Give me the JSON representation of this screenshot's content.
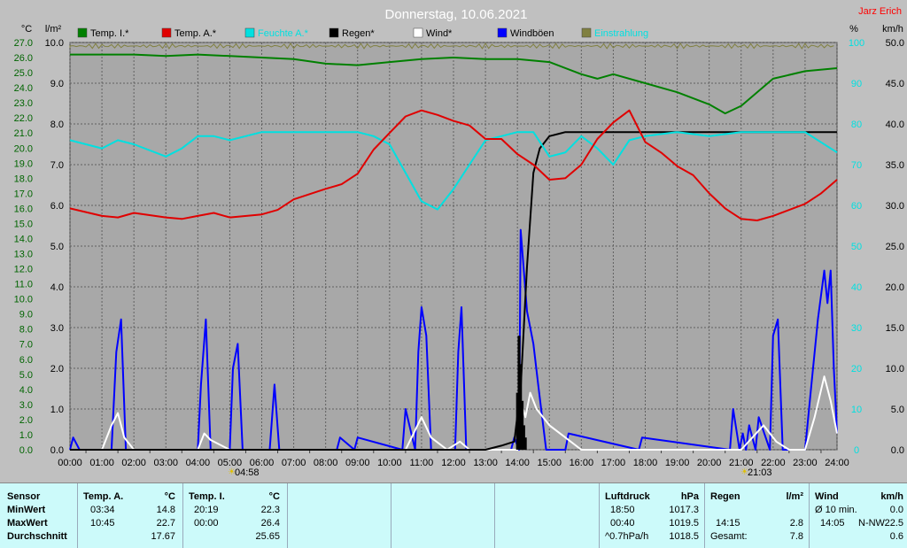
{
  "title": "Donnerstag, 10.06.2021",
  "author": "Jarz Erich",
  "colors": {
    "temp_i": "#008000",
    "temp_a": "#e00000",
    "feuchte": "#00e0e0",
    "regen": "#000000",
    "wind": "#ffffff",
    "windboeen": "#0000ff",
    "einstrahlung": "#808040",
    "plot_bg": "#a8a8a8",
    "grid": "#606060",
    "left_axis": "#006400",
    "panel_bg": "#ccfafa",
    "author": "#ff0000"
  },
  "chart_data": {
    "type": "line",
    "title": "Donnerstag, 10.06.2021",
    "x_unit": "hour",
    "xlim": [
      0,
      24
    ],
    "x_ticks": [
      "00:00",
      "01:00",
      "02:00",
      "03:00",
      "04:00",
      "05:00",
      "06:00",
      "07:00",
      "08:00",
      "09:00",
      "10:00",
      "11:00",
      "12:00",
      "13:00",
      "14:00",
      "15:00",
      "16:00",
      "17:00",
      "18:00",
      "19:00",
      "20:00",
      "21:00",
      "22:00",
      "23:00",
      "24:00"
    ],
    "axes": {
      "temp": {
        "label": "°C",
        "ylim": [
          0,
          27
        ],
        "ticks": [
          "0.0",
          "1.0",
          "2.0",
          "3.0",
          "4.0",
          "5.0",
          "6.0",
          "7.0",
          "8.0",
          "9.0",
          "10.0",
          "11.0",
          "12.0",
          "13.0",
          "14.0",
          "15.0",
          "16.0",
          "17.0",
          "18.0",
          "19.0",
          "20.0",
          "21.0",
          "22.0",
          "23.0",
          "24.0",
          "25.0",
          "26.0",
          "27.0"
        ]
      },
      "rain": {
        "label": "l/m²",
        "ylim": [
          0,
          10
        ],
        "ticks": [
          "0.0",
          "1.0",
          "2.0",
          "3.0",
          "4.0",
          "5.0",
          "6.0",
          "7.0",
          "8.0",
          "9.0",
          "10.0"
        ]
      },
      "humidity": {
        "label": "%",
        "ylim": [
          0,
          100
        ],
        "ticks": [
          "0",
          "10",
          "20",
          "30",
          "40",
          "50",
          "60",
          "70",
          "80",
          "90",
          "100"
        ]
      },
      "wind": {
        "label": "km/h",
        "ylim": [
          0,
          50
        ],
        "ticks": [
          "0.0",
          "5.0",
          "10.0",
          "15.0",
          "20.0",
          "25.0",
          "30.0",
          "35.0",
          "40.0",
          "45.0",
          "50.0"
        ]
      }
    },
    "legend": [
      "Temp. I.*",
      "Temp. A.*",
      "Feuchte A.*",
      "Regen*",
      "Wind*",
      "Windböen",
      "Einstrahlung"
    ],
    "sunrise": "04:58",
    "sunset": "21:03",
    "series": [
      {
        "name": "Temp. I.*",
        "axis": "temp",
        "color": "#008000",
        "x": [
          0,
          2,
          3,
          4,
          5,
          6,
          7,
          8,
          9,
          10,
          11,
          12,
          13,
          14,
          15,
          16,
          16.5,
          17,
          18,
          19,
          20,
          20.5,
          21,
          21.5,
          22,
          23,
          24
        ],
        "y": [
          26.2,
          26.2,
          26.1,
          26.2,
          26.1,
          26.0,
          25.9,
          25.6,
          25.5,
          25.7,
          25.9,
          26.0,
          25.9,
          25.9,
          25.7,
          24.9,
          24.6,
          24.9,
          24.3,
          23.7,
          22.9,
          22.3,
          22.8,
          23.7,
          24.6,
          25.1,
          25.3
        ]
      },
      {
        "name": "Temp. A.*",
        "axis": "temp",
        "color": "#e00000",
        "x": [
          0,
          1,
          1.5,
          2,
          3,
          3.5,
          4,
          4.5,
          5,
          6,
          6.5,
          7,
          8,
          8.5,
          9,
          9.5,
          10,
          10.5,
          11,
          11.5,
          12,
          12.5,
          13,
          13.5,
          14,
          14.5,
          15,
          15.5,
          16,
          16.5,
          17,
          17.5,
          18,
          18.5,
          19,
          19.5,
          20,
          20.5,
          21,
          21.5,
          22,
          23,
          23.5,
          24
        ],
        "y": [
          16.0,
          15.5,
          15.4,
          15.7,
          15.4,
          15.3,
          15.5,
          15.7,
          15.4,
          15.6,
          15.9,
          16.6,
          17.3,
          17.6,
          18.3,
          19.9,
          21.0,
          22.1,
          22.5,
          22.2,
          21.8,
          21.5,
          20.6,
          20.6,
          19.6,
          18.9,
          17.9,
          18.0,
          18.9,
          20.6,
          21.7,
          22.5,
          20.4,
          19.7,
          18.8,
          18.2,
          17.0,
          16.0,
          15.3,
          15.2,
          15.5,
          16.3,
          17.0,
          17.9
        ]
      },
      {
        "name": "Feuchte A.*",
        "axis": "humidity",
        "color": "#00e0e0",
        "x": [
          0,
          1,
          1.5,
          2,
          3,
          3.5,
          4,
          4.5,
          5,
          6,
          7,
          8,
          9,
          9.5,
          10,
          10.5,
          11,
          11.5,
          12,
          12.5,
          13,
          13.5,
          14,
          14.5,
          15,
          15.5,
          16,
          16.5,
          17,
          17.5,
          18,
          19,
          20,
          21,
          21.5,
          22,
          23,
          24
        ],
        "y": [
          76,
          74,
          76,
          75,
          72,
          74,
          77,
          77,
          76,
          78,
          78,
          78,
          78,
          77,
          75,
          68,
          61,
          59,
          64,
          70,
          76,
          77,
          78,
          78,
          72,
          73,
          77,
          74,
          70,
          76,
          77,
          78,
          77,
          78,
          78,
          78,
          78,
          73
        ]
      },
      {
        "name": "Regen*",
        "axis": "rain",
        "color": "#000000",
        "x": [
          0,
          13,
          13.5,
          13.9,
          14.1,
          14.3,
          14.5,
          14.7,
          15,
          15.5,
          16,
          24
        ],
        "y": [
          0,
          0,
          0.1,
          0.2,
          1.5,
          4.5,
          6.8,
          7.4,
          7.7,
          7.8,
          7.8,
          7.8
        ]
      },
      {
        "name": "Windböen",
        "axis": "wind",
        "color": "#0000ff",
        "x": [
          0,
          0.1,
          0.3,
          1.3,
          1.45,
          1.6,
          1.75,
          4,
          4.1,
          4.25,
          4.4,
          5,
          5.1,
          5.25,
          5.4,
          6.25,
          6.4,
          6.55,
          8.35,
          8.45,
          8.9,
          9,
          10.4,
          10.5,
          10.8,
          10.9,
          11,
          11.15,
          11.3,
          12.05,
          12.15,
          12.25,
          12.4,
          13.8,
          13.9,
          14.05,
          14.1,
          14.3,
          14.5,
          14.65,
          14.9,
          15.5,
          15.6,
          17.8,
          17.9,
          20.65,
          20.75,
          20.95,
          21.05,
          21.15,
          21.25,
          21.45,
          21.55,
          21.9,
          22,
          22.15,
          22.3,
          23,
          23.2,
          23.4,
          23.6,
          23.7,
          23.8,
          23.9,
          24
        ],
        "y": [
          0,
          1.5,
          0,
          0,
          12,
          16,
          0,
          0,
          8,
          16,
          0,
          0,
          10,
          13,
          0,
          0,
          8,
          0,
          0,
          1.5,
          0,
          1.5,
          0,
          5,
          0,
          12,
          17.5,
          14,
          0,
          0,
          12,
          17.5,
          0,
          0,
          1.5,
          0,
          27,
          17,
          13,
          8,
          0,
          0,
          2,
          0,
          1.5,
          0,
          5,
          0,
          2,
          0,
          3,
          0,
          4,
          0,
          14,
          16,
          0,
          0,
          8,
          16,
          22,
          18,
          22,
          10,
          2
        ]
      },
      {
        "name": "Wind*",
        "axis": "wind",
        "color": "#ffffff",
        "x": [
          0,
          1,
          1.3,
          1.5,
          1.7,
          2,
          4,
          4.2,
          4.4,
          5,
          10.5,
          11,
          11.3,
          11.8,
          12.2,
          12.5,
          14,
          14.1,
          14.25,
          14.4,
          14.6,
          15,
          15.5,
          16,
          21,
          21.7,
          22.1,
          22.5,
          23,
          23.3,
          23.6,
          23.8,
          24
        ],
        "y": [
          0,
          0,
          3,
          4.5,
          1.5,
          0,
          0,
          2,
          1.2,
          0,
          0,
          4,
          1.5,
          0,
          1,
          0,
          0,
          6,
          4,
          7,
          5,
          3,
          1.5,
          0,
          0,
          3,
          1,
          0,
          0,
          4,
          9,
          6,
          2
        ]
      }
    ]
  },
  "stats": {
    "sensor_header": "Sensor",
    "row1": "MinWert",
    "row2": "MaxWert",
    "row3": "Durchschnitt",
    "ta": {
      "header": "Temp. A.",
      "unit": "°C",
      "min_time": "03:34",
      "min": "14.8",
      "max_time": "10:45",
      "max": "22.7",
      "avg": "17.67"
    },
    "ti": {
      "header": "Temp. I.",
      "unit": "°C",
      "min_time": "20:19",
      "min": "22.3",
      "max_time": "00:00",
      "max": "26.4",
      "avg": "25.65"
    },
    "druck": {
      "header": "Luftdruck",
      "unit": "hPa",
      "min_time": "18:50",
      "min": "1017.3",
      "max_time": "00:40",
      "max": "1019.5",
      "trend_label": "^0.7hPa/h",
      "avg": "1018.5"
    },
    "regen": {
      "header": "Regen",
      "unit": "l/m²",
      "max_time": "14:15",
      "max": "2.8",
      "total_label": "Gesamt:",
      "total": "7.8"
    },
    "wind": {
      "header": "Wind",
      "unit": "km/h",
      "avg_label": "Ø 10 min.",
      "avg": "0.0",
      "max_time": "14:05",
      "max_dir": "N-NW",
      "max": "22.5",
      "last": "0.6"
    }
  }
}
